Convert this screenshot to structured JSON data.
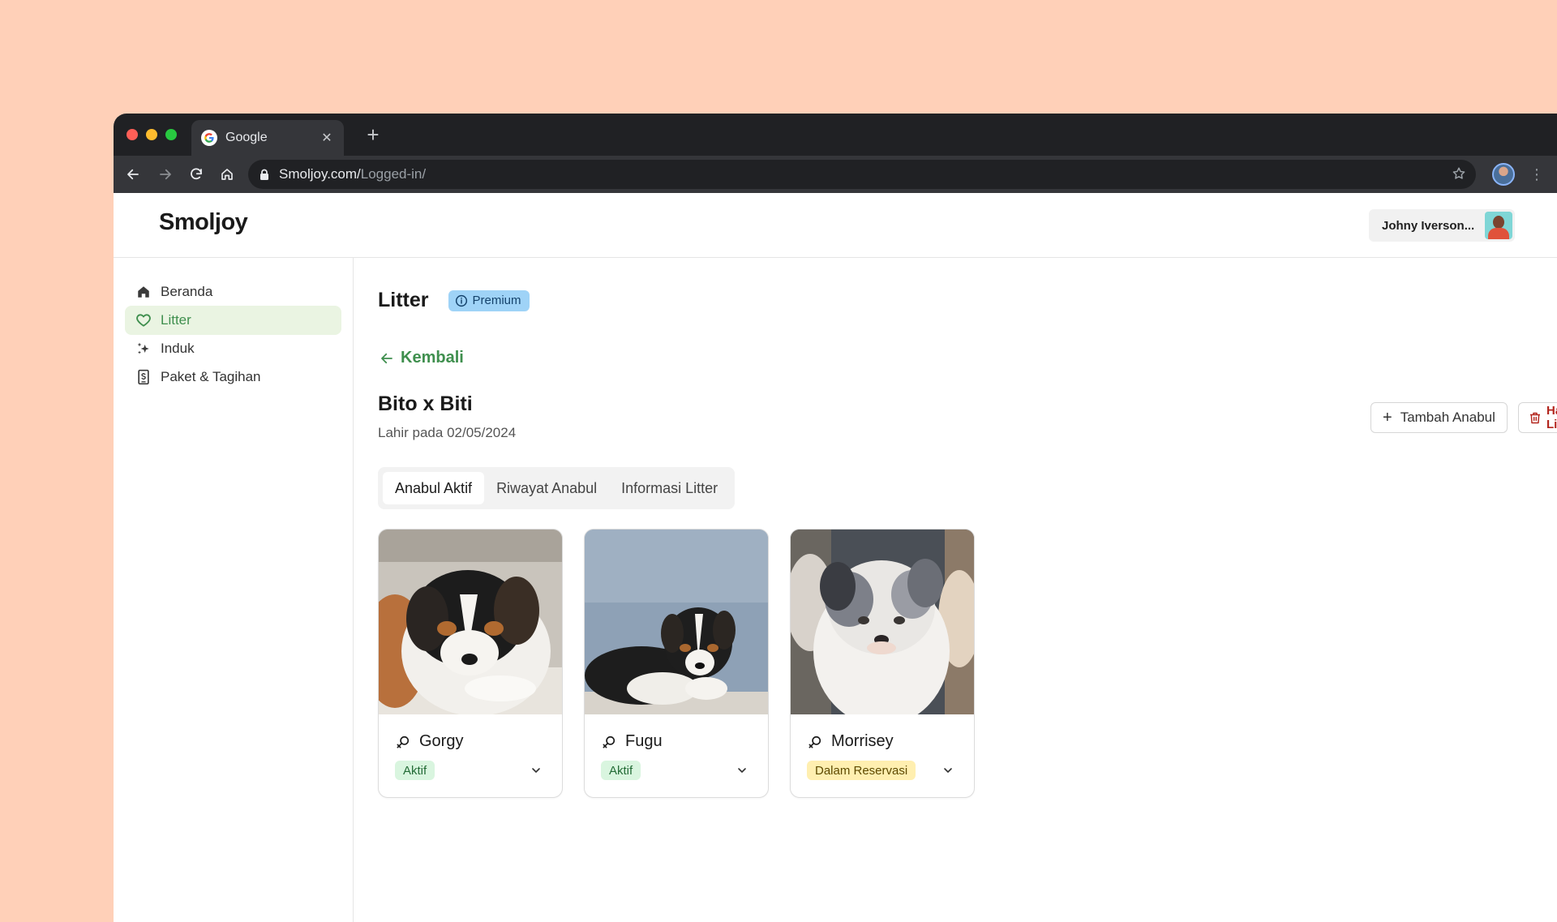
{
  "browser": {
    "tab_title": "Google",
    "url_host": "Smoljoy.com/",
    "url_path": "Logged-in/",
    "traffic_lights": [
      "#ff5f57",
      "#febc2e",
      "#28c840"
    ]
  },
  "header": {
    "logo": "Smoljoy",
    "user_name": "Johny Iverson..."
  },
  "sidebar": {
    "items": [
      {
        "label": "Beranda",
        "icon": "home-icon",
        "active": false
      },
      {
        "label": "Litter",
        "icon": "heart-icon",
        "active": true
      },
      {
        "label": "Induk",
        "icon": "sparkle-icon",
        "active": false
      },
      {
        "label": "Paket & Tagihan",
        "icon": "receipt-icon",
        "active": false
      }
    ]
  },
  "main": {
    "title": "Litter",
    "badge": "Premium",
    "back_label": "Kembali",
    "litter_name": "Bito x Biti",
    "birth_date": "Lahir pada 02/05/2024",
    "add_button": "Tambah Anabul",
    "delete_button": "Hapus Litter",
    "tabs": [
      {
        "label": "Anabul Aktif",
        "selected": true
      },
      {
        "label": "Riwayat Anabul",
        "selected": false
      },
      {
        "label": "Informasi Litter",
        "selected": false
      }
    ],
    "puppies": [
      {
        "name": "Gorgy",
        "status": "Aktif",
        "status_type": "active"
      },
      {
        "name": "Fugu",
        "status": "Aktif",
        "status_type": "active"
      },
      {
        "name": "Morrisey",
        "status": "Dalam Reservasi",
        "status_type": "reserved"
      }
    ]
  },
  "colors": {
    "accent_green": "#3f8f4e",
    "active_nav_bg": "#eaf4e2",
    "premium_bg": "#9fd3f7",
    "danger": "#b3261e",
    "page_bg": "#ffd0b8"
  }
}
